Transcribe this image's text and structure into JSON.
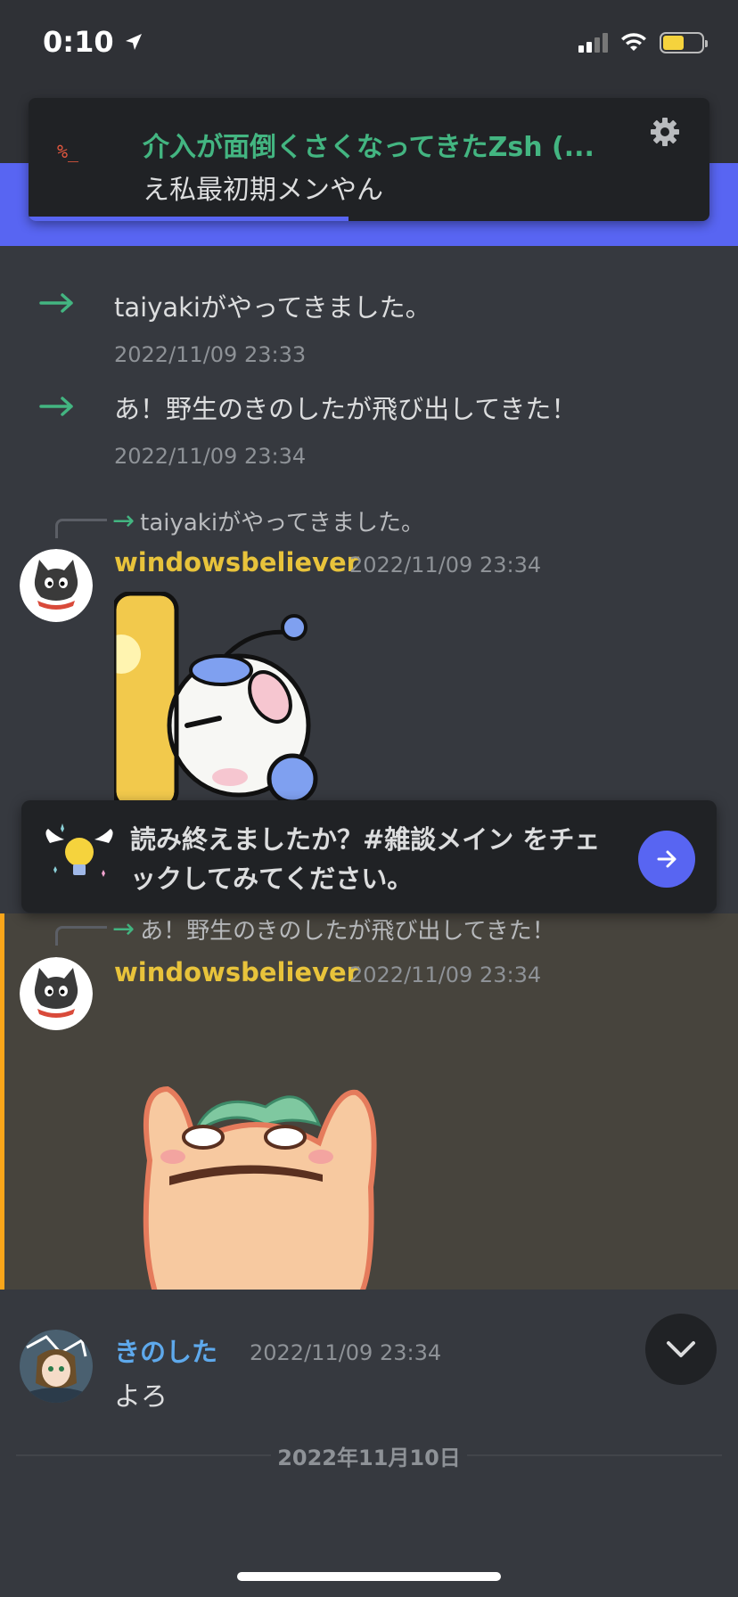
{
  "status_bar": {
    "time": "0:10"
  },
  "thread": {
    "title": "介入が面倒くさくなってきたZsh (...",
    "subtitle": "え私最初期メンやん",
    "icon_text": "%_",
    "progress": 0.47
  },
  "system_messages": [
    {
      "text": "taiyakiがやってきました。",
      "time": "2022/11/09 23:33"
    },
    {
      "text": "あ！野生のきのしたが飛び出してきた！",
      "time": "2022/11/09 23:34"
    }
  ],
  "messages": [
    {
      "reply_to": "taiyakiがやってきました。",
      "username": "windowsbeliever",
      "time": "2022/11/09 23:34",
      "username_color": "#e8c33b"
    },
    {
      "reply_to": "あ！野生のきのしたが飛び出してきた！",
      "username": "windowsbeliever",
      "time": "2022/11/09 23:34",
      "username_color": "#e8c33b"
    },
    {
      "username": "きのした",
      "time": "2022/11/09 23:34",
      "text": "よろ",
      "username_color": "#5ea9ec"
    }
  ],
  "banner": {
    "text": "読み終えましたか？#雑談メイン をチェックしてみてください。"
  },
  "date_divider": "2022年11月10日",
  "colors": {
    "background": "#36393f",
    "accent": "#5865f2",
    "highlight": "#47443d",
    "highlight_bar": "#faa61a",
    "green": "#43b581"
  }
}
